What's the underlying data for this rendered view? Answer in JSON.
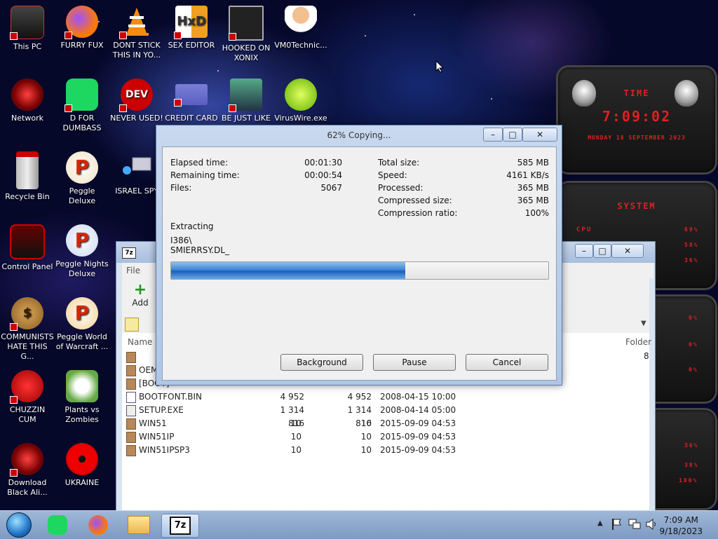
{
  "desktop_icons": [
    {
      "label": "This PC"
    },
    {
      "label": "FURRY FUX"
    },
    {
      "label": "DONT STICK THIS IN YO..."
    },
    {
      "label": "SEX EDITOR"
    },
    {
      "label": "HOOKED ON XONIX"
    },
    {
      "label": "VM0Technic..."
    },
    {
      "label": "Network"
    },
    {
      "label": "D FOR DUMBASS"
    },
    {
      "label": "NEVER USED!"
    },
    {
      "label": "CREDIT CARD"
    },
    {
      "label": "BE JUST LIKE"
    },
    {
      "label": "VirusWire.exe"
    },
    {
      "label": "Recycle Bin"
    },
    {
      "label": "Peggle Deluxe"
    },
    {
      "label": "ISRAEL SPY"
    },
    {
      "label": "Control Panel"
    },
    {
      "label": "Peggle Nights Deluxe"
    },
    {
      "label": "COMMUNISTS HATE THIS G..."
    },
    {
      "label": "Peggle World of Warcraft ..."
    },
    {
      "label": "CHUZZIN CUM"
    },
    {
      "label": "Plants vs Zombies"
    },
    {
      "label": "Download Black Ali..."
    },
    {
      "label": "UKRAINE"
    }
  ],
  "gadget": {
    "time_title": "TIME",
    "time": "7:09:02",
    "date": "MONDAY 18 SEPTEMBER 2023",
    "system_title": "SYSTEM",
    "cpu_label": "CPU",
    "cpu_values": [
      "69%",
      "58%",
      "36%"
    ],
    "other_values": [
      "0%",
      "0%",
      "0%",
      "36%",
      "38%",
      "100%"
    ]
  },
  "zip_window": {
    "menu_file": "File",
    "add_label": "Add",
    "col_name": "Name",
    "col_folder": "Folder",
    "folder_count": "8",
    "rows": [
      {
        "name": "",
        "size": "",
        "packed": "",
        "modified": ""
      },
      {
        "name": "OEM",
        "size": "",
        "packed": "",
        "modified": ""
      },
      {
        "name": "[BOOT]",
        "size": "",
        "packed": "",
        "modified": ""
      },
      {
        "name": "BOOTFONT.BIN",
        "size": "4 952",
        "packed": "4 952",
        "modified": "2008-04-15 10:00"
      },
      {
        "name": "SETUP.EXE",
        "size": "1 314 816",
        "packed": "1 314 816",
        "modified": "2008-04-14 05:00"
      },
      {
        "name": "WIN51",
        "size": "10",
        "packed": "10",
        "modified": "2015-09-09 04:53"
      },
      {
        "name": "WIN51IP",
        "size": "10",
        "packed": "10",
        "modified": "2015-09-09 04:53"
      },
      {
        "name": "WIN51IPSP3",
        "size": "10",
        "packed": "10",
        "modified": "2015-09-09 04:53"
      }
    ]
  },
  "dialog": {
    "title": "62% Copying...",
    "progress_percent": 62,
    "elapsed_label": "Elapsed time:",
    "elapsed_value": "00:01:30",
    "remaining_label": "Remaining time:",
    "remaining_value": "00:00:54",
    "files_label": "Files:",
    "files_value": "5067",
    "total_label": "Total size:",
    "total_value": "585 MB",
    "speed_label": "Speed:",
    "speed_value": "4161 KB/s",
    "processed_label": "Processed:",
    "processed_value": "365 MB",
    "compressed_label": "Compressed size:",
    "compressed_value": "365 MB",
    "ratio_label": "Compression ratio:",
    "ratio_value": "100%",
    "operation": "Extracting",
    "path_line1": "I386\\",
    "path_line2": "SMIERRSY.DL_",
    "background_btn": "Background",
    "pause_btn": "Pause",
    "cancel_btn": "Cancel"
  },
  "taskbar": {
    "time": "7:09 AM",
    "date": "9/18/2023",
    "zip_label": "7z"
  }
}
